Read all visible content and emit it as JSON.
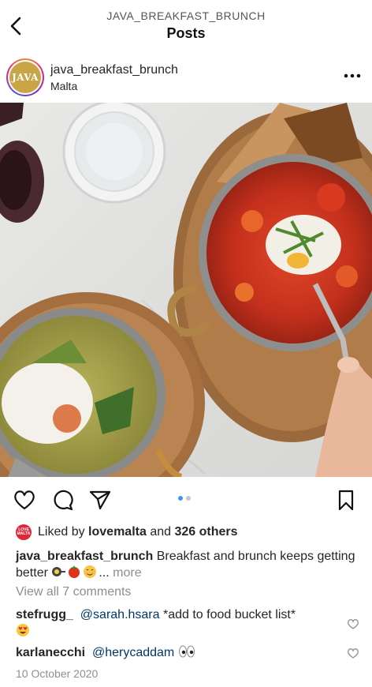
{
  "topbar": {
    "subtitle": "JAVA_BREAKFAST_BRUNCH",
    "title": "Posts"
  },
  "post": {
    "avatar_text": "JAVA",
    "username": "java_breakfast_brunch",
    "location": "Malta",
    "carousel": {
      "count": 2,
      "active_index": 0
    },
    "likes": {
      "liker_avatar_text": "LOVE MALTA",
      "prefix": "Liked by",
      "liker": "lovemalta",
      "middle": "and",
      "others": "326 others"
    },
    "caption": {
      "username": "java_breakfast_brunch",
      "text": " Breakfast and brunch keeps getting better",
      "emojis": [
        "pan-icon",
        "tomato-icon",
        "smiling-face-icon"
      ],
      "ellipsis": "...",
      "more": "more"
    },
    "view_all_comments": "View all 7 comments",
    "comments": [
      {
        "username": "stefrugg_",
        "mention": "@sarah.hsara",
        "text": " *add to food bucket list*",
        "emoji": "heart-eyes-icon"
      },
      {
        "username": "karlanecchi",
        "mention": "@herycaddam",
        "text": "",
        "emoji": "eyes-icon"
      }
    ],
    "date": "10 October 2020"
  },
  "colors": {
    "link": "#00376b",
    "muted": "#8e8e8e",
    "carousel_active": "#3897f0",
    "avatar_gold": "#c9a548"
  }
}
